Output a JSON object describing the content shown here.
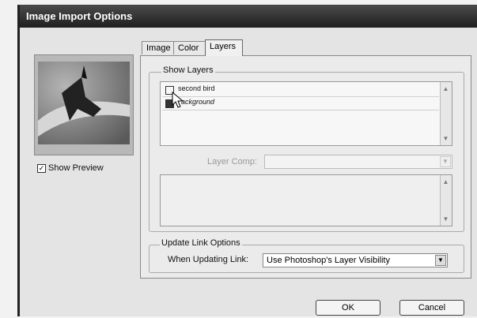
{
  "window": {
    "title": "Image Import Options"
  },
  "preview": {
    "show_preview_label": "Show Preview",
    "show_preview_checked": true
  },
  "tabs": [
    {
      "label": "Image",
      "active": false
    },
    {
      "label": "Color",
      "active": false
    },
    {
      "label": "Layers",
      "active": true
    }
  ],
  "show_layers": {
    "title": "Show Layers",
    "layers": [
      {
        "name": "second bird",
        "visible": false
      },
      {
        "name": "ackground",
        "visible": true
      }
    ]
  },
  "layer_comp": {
    "label": "Layer Comp:",
    "value": ""
  },
  "update_link": {
    "title": "Update Link Options",
    "label": "When Updating Link:",
    "value": "Use Photoshop's Layer Visibility"
  },
  "buttons": {
    "ok": "OK",
    "cancel": "Cancel"
  }
}
